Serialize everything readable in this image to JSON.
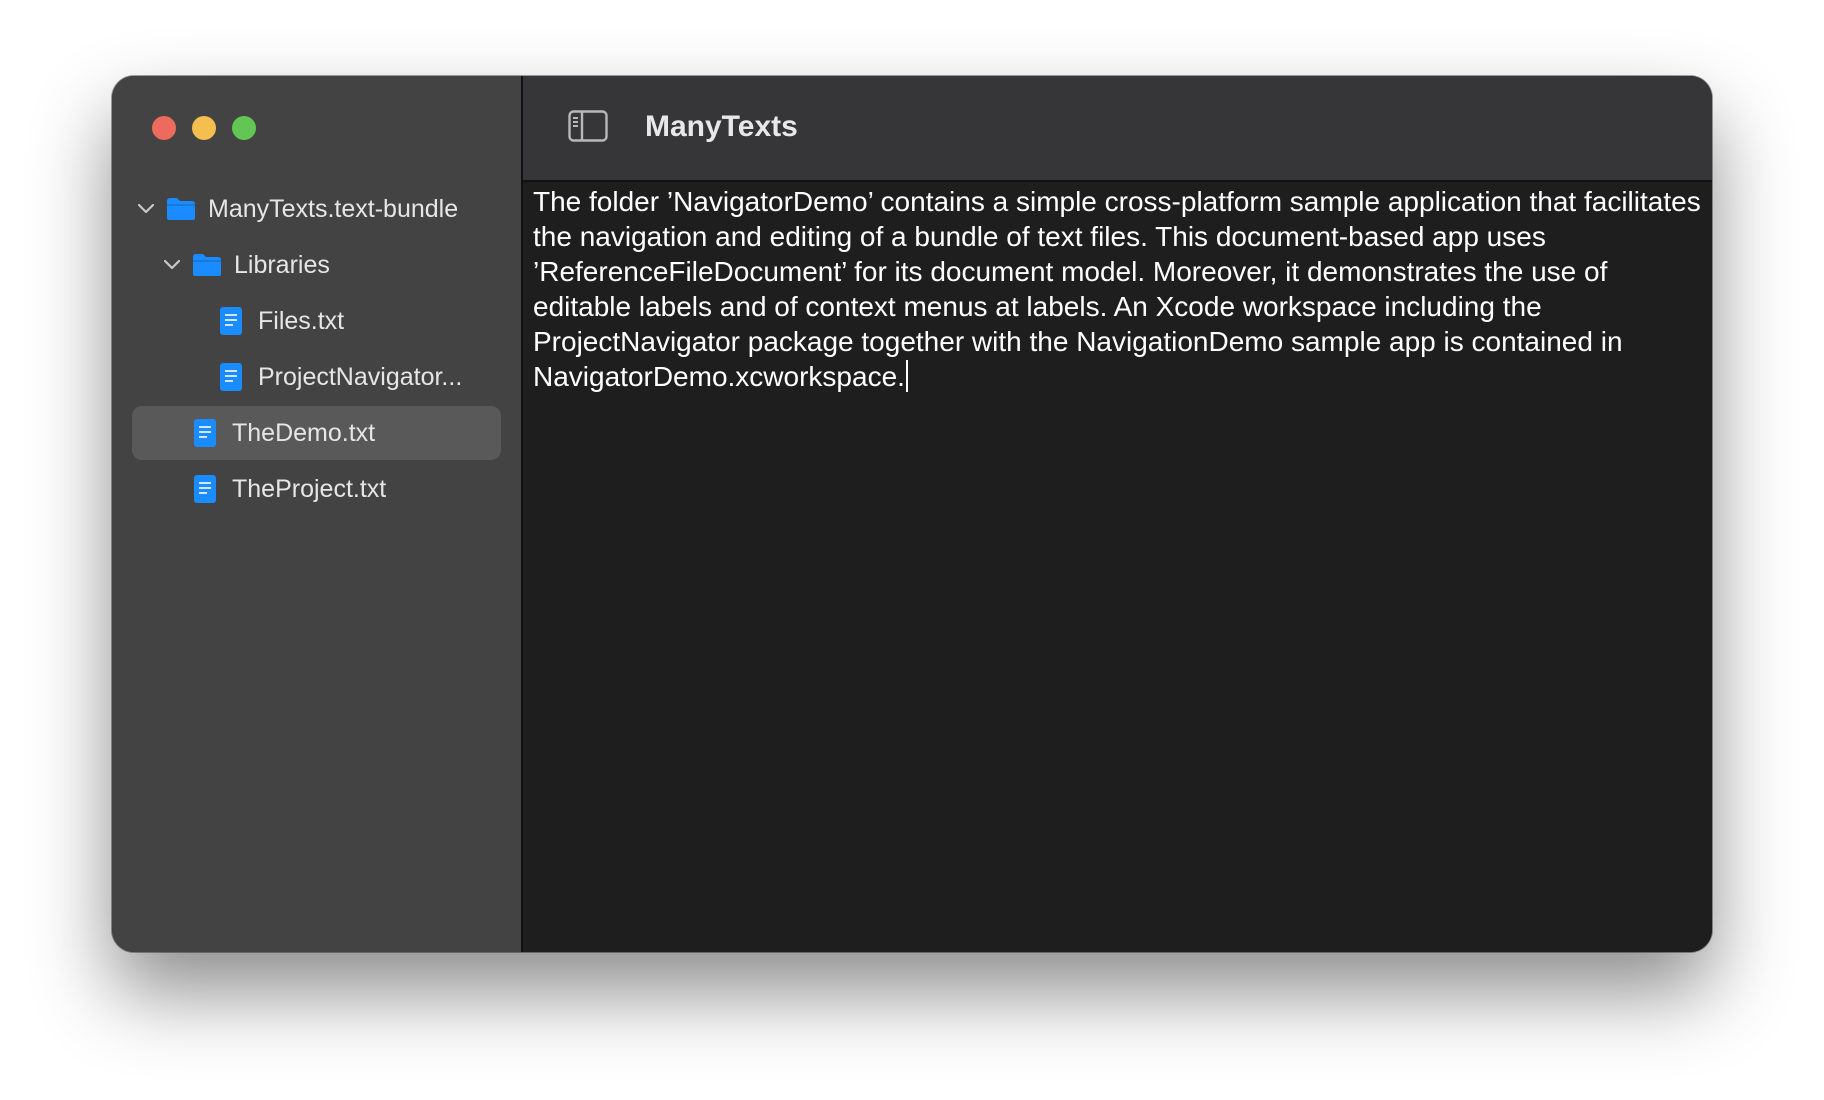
{
  "window": {
    "title": "ManyTexts"
  },
  "sidebar": {
    "tree": [
      {
        "label": "ManyTexts.text-bundle",
        "kind": "folder",
        "expanded": true,
        "icon": "folder-icon"
      },
      {
        "label": "Libraries",
        "kind": "folder",
        "expanded": true,
        "icon": "folder-icon"
      },
      {
        "label": "Files.txt",
        "kind": "file",
        "icon": "document-icon"
      },
      {
        "label": "ProjectNavigator...",
        "kind": "file",
        "icon": "document-icon"
      },
      {
        "label": "TheDemo.txt",
        "kind": "file",
        "icon": "document-icon",
        "selected": true
      },
      {
        "label": "TheProject.txt",
        "kind": "file",
        "icon": "document-icon"
      }
    ]
  },
  "editor": {
    "text": "The folder ’NavigatorDemo’ contains a simple cross-platform sample application that facilitates the navigation and editing of a bundle of text files. This document-based app uses ’ReferenceFileDocument’ for its document model. Moreover, it demonstrates the use of editable labels and of context menus at labels. An Xcode workspace including the ProjectNavigator package together with the NavigationDemo sample app is contained in NavigatorDemo.xcworkspace."
  },
  "colors": {
    "accent_blue": "#1a8cff",
    "sidebar_bg": "#434343",
    "selection_bg": "#595959",
    "titlebar_bg": "#363538",
    "editor_bg": "#1e1e1e",
    "close": "#ed6a5e",
    "minimize": "#f5bf4f",
    "zoom": "#62c554"
  }
}
